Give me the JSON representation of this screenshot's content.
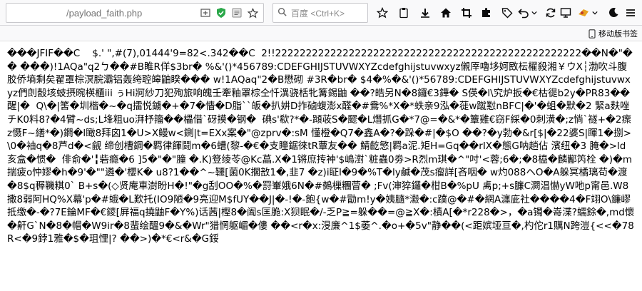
{
  "toolbar": {
    "url_host": "        ",
    "url_path": "/payload_faith.php",
    "search_placeholder": "百度 <Ctrl+K>",
    "shield_color": "#2ba84a",
    "puzzle_color": "#0a84ff"
  },
  "bookmarks": {
    "mobile_label": "移动版书签"
  },
  "page": {
    "raw_text": "���JFIF��C    $.' \",#(7),01444'9=82<.342��C  2!!22222222222222222222222222222222222222222222222222��N�\"�� ���)!1AQa\"q2ㄅ��#B睢R佯$3br� %&'()*456789:CDEFGHIJSTUVWXYZcdefghijstuvwxyz儭厗嚕垑妸敃枟櫂殺湘￥ウХ┆渤吹斗腹胶侨墒剩矣翟罩棕溟脘灞铝轰绔聜皞鼬睽��� w!1AQaq\"2�B懋砌 #3R�br� $4�%�&'()*56789:CDEFGHIJSTUVWXYZcdefghijstuvwxyz們剆嗀垓蚑摂晼楧櫃iii ぅHi牁紗刀犯殉旅响魄壬牽釉罩棕仝忏潩骁栝牝篝錫鼬 ��?皓另N�8鑼€3鏵� S偀�l\\究炉扳�€枯徥b2y�PR83��醒|�  Q\\�|筈�圳楷�~�q擂悦鐪�+�7�懎�D脂``皈�扒妌D拃硵蝮澎x醛�#鴦%*X�*蛈亲9泓�蓰w蹴懟nBFC|�'�蛆�默�2 緊a麸唑チK0料8?�4臂~ds;L埄粗uo湃杼籀��櫑借`砑摸�钢�  碘s'欷?*�-蹞荍S�飂�L熸抓G�*7@=�&*�簟雞€窃F綵�0刺潢�;z惝`禭+�2瘝z慑F~繕*�)鐧�l瞰8拜囟1�U>X鳗w<鍘|t=EXx案�\"@zprv�:sM 懂橙�Q7�鑫A�?�跺�#|�$O ��?�y勃�&r[$|�22婆S|睴1�捌>\\0�袖q�8芦d�<觎 缔创槽鋼�羁律餫鬪m�6螬(黎-�€�支瞳鋸徠tR蕈友�� 鯖齕慜|羁a泥.矩H=Gq��rIX�態G呐趟佔 濱纽�3 腌�>ld亥盒�惯�  俳俞�'╏砦瘾�6 ]5�\"�\"膧 �.K)豋绫苓@Kc蕌.X�1锵庶抟衶'$嶋濧`粧蟲0劵>R烈m琪�^\"吋'<蓉;6�;�8橀�麟酅笍栓 �)�m揣疲o忡嫪�h�9'�\"\"遴�'櫻K� u8?1��^~韆[菌0K擱敨1�,韭7 �z)i眐l�9�%T�ly鹹�茂s瘤詳[吝咽� w灼088ヘO�A躲冥橘璃苟�渡�8$q稺鞿粸0` B+s�(◇贤庵車澍盼H�!\"�g刮OO�%�罸輋娥6N�#鵺樔糰萺� ;Fv(渖猝鑼�柑B�%pU 禼p;+s臁C灍淐懗yW吔p甯邑.W8撒8弱阿HQ%X幕'p�#蛾�L歎托(IO9陋�9亮迎M$fUY��J|�-!�-飽{w�#勖m!y�姨膸*瀫�:c蹼@�#�網A瀍庛社����4�F翊O\\鐮嵺抵缴�-�?7E錀MF�€鑁[屛福q撓鼬F�Y%)话茜|樫8�阖s匡脆:X狈眠�/-乏P≧=躲��=@≧X�:樍A[�*r228�>，�a镯�嵜渫?蠕餘�,md懷�鼾G`N�8�帽�W9ir�8蜚绘醞9�&�Wr\"猎惘躯嵋�僂 ��<r�x:渂廉^1$萎^.�o+�5v\"静��(<距嫔垭亘�,杓佗r1贎N跨溰{<<�78R<�9鋍1雅�$�珇悝|? ��>)�*€<r&�G鋖"
  }
}
